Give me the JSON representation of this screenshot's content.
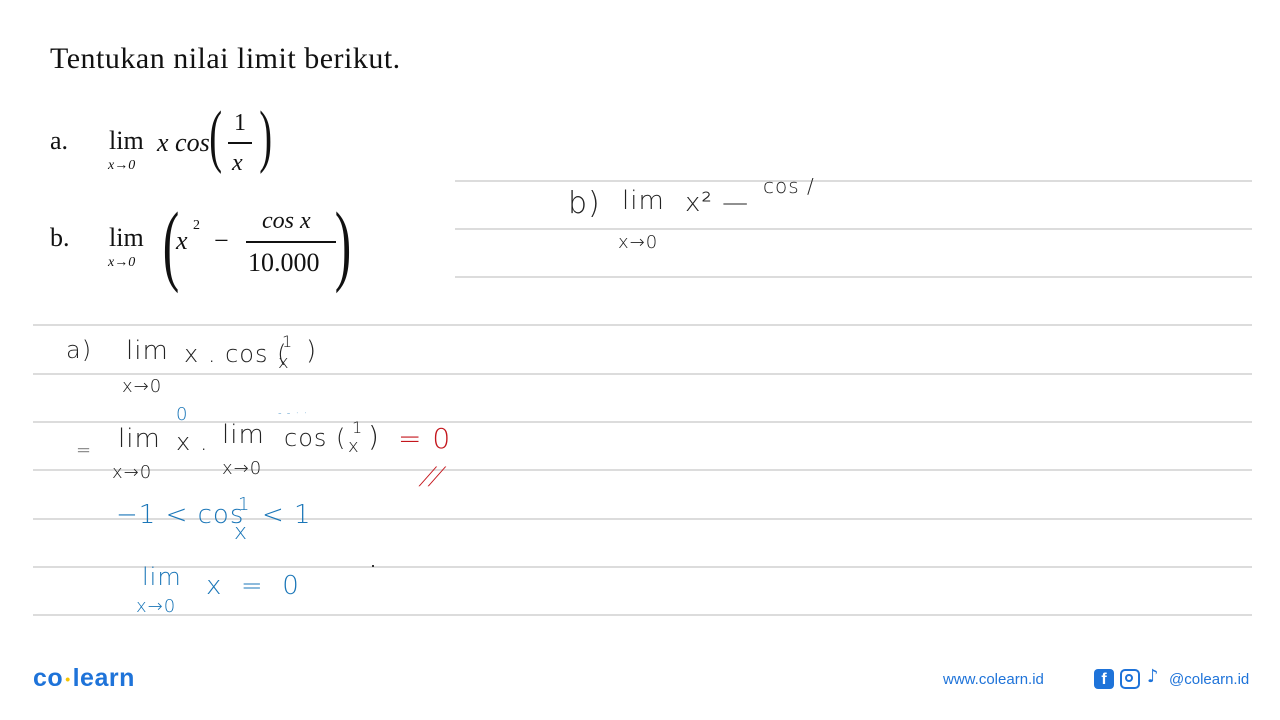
{
  "problem": {
    "title": "Tentukan nilai limit berikut.",
    "items": [
      {
        "label": "a.",
        "lim": "lim",
        "sub": "x→0",
        "expr_prefix": "x cos",
        "frac_num": "1",
        "frac_den": "x"
      },
      {
        "label": "b.",
        "lim": "lim",
        "sub": "x→0",
        "term1": "x",
        "term1_exp": "2",
        "minus": "−",
        "frac_num": "cos x",
        "frac_den": "10.000"
      }
    ]
  },
  "handwriting": {
    "b_work": {
      "label": "b)",
      "lim": "lim",
      "sub": "x→0",
      "expr": "x² —",
      "partial": "cos /"
    },
    "a_work": {
      "line1": {
        "label": "a)",
        "lim": "lim",
        "sub": "x→0",
        "expr": "x . cos ( ",
        "frac_num": "1",
        "frac_den": "x",
        "close": ")"
      },
      "line2": {
        "eq": "=",
        "lim1": "lim",
        "sub1": "x→0",
        "x": "x .",
        "x_annotation": "0",
        "lim2": "lim",
        "sub2": "x→0",
        "dots": "- - · ·",
        "cos": "cos ( ",
        "frac_num": "1",
        "frac_den": "x",
        "close": ")",
        "result": "= 0",
        "underline_mark": "//"
      },
      "line3": {
        "left": "−1 < cos",
        "frac_num": "1",
        "frac_den": "x",
        "right": "< 1"
      },
      "line4": {
        "lim": "lim",
        "sub": "x→0",
        "expr": "x  =  0"
      }
    },
    "colors": {
      "ink_black": "#222222",
      "ink_blue": "#1a76b8",
      "ink_red": "#c4161c"
    }
  },
  "footer": {
    "logo_left": "co",
    "logo_dot": "•",
    "logo_right": "learn",
    "website": "www.colearn.id",
    "social_icons": [
      "facebook-icon",
      "instagram-icon",
      "tiktok-icon"
    ],
    "facebook_glyph": "f",
    "tiktok_glyph": "♪",
    "handle": "@colearn.id",
    "brand_color": "#1e73d9"
  }
}
